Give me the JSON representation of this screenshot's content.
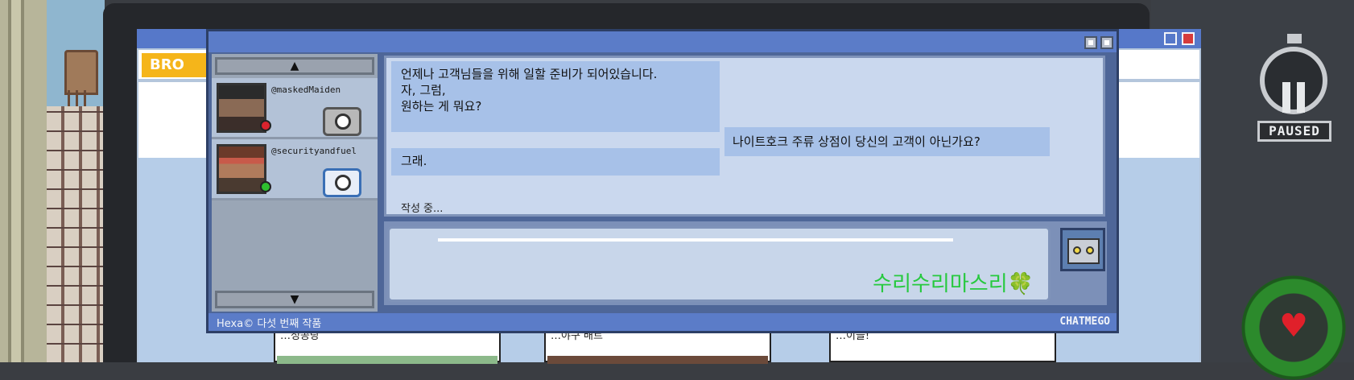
{
  "timer": {
    "status_label": "PAUSED"
  },
  "browser": {
    "brand": "BRO",
    "cards": [
      {
        "text": "…성공당"
      },
      {
        "text": "…야구 배트"
      },
      {
        "text": "…이들!"
      }
    ]
  },
  "chat": {
    "contacts": [
      {
        "name": "@maskedMaiden",
        "status_color": "#d9232e"
      },
      {
        "name": "@securityandfuel",
        "status_color": "#2ec02e"
      }
    ],
    "messages": [
      {
        "side": "left",
        "text": "언제나 고객님들을 위해 일할 준비가 되어있습니다.\n자, 그럼,\n원하는 게 뭐요?"
      },
      {
        "side": "right",
        "text": "나이트호크 주류 상점이 당신의 고객이 아닌가요?"
      },
      {
        "side": "left",
        "text": "그래."
      }
    ],
    "typing_indicator": "작성 중...",
    "compose_text": "수리수리마스리🍀",
    "footer_left": "Hexa© 다섯 번째 작품",
    "footer_right": "CHATMEGO"
  },
  "icons": {
    "scroll_up": "▲",
    "scroll_down": "▼",
    "heart": "♥"
  }
}
